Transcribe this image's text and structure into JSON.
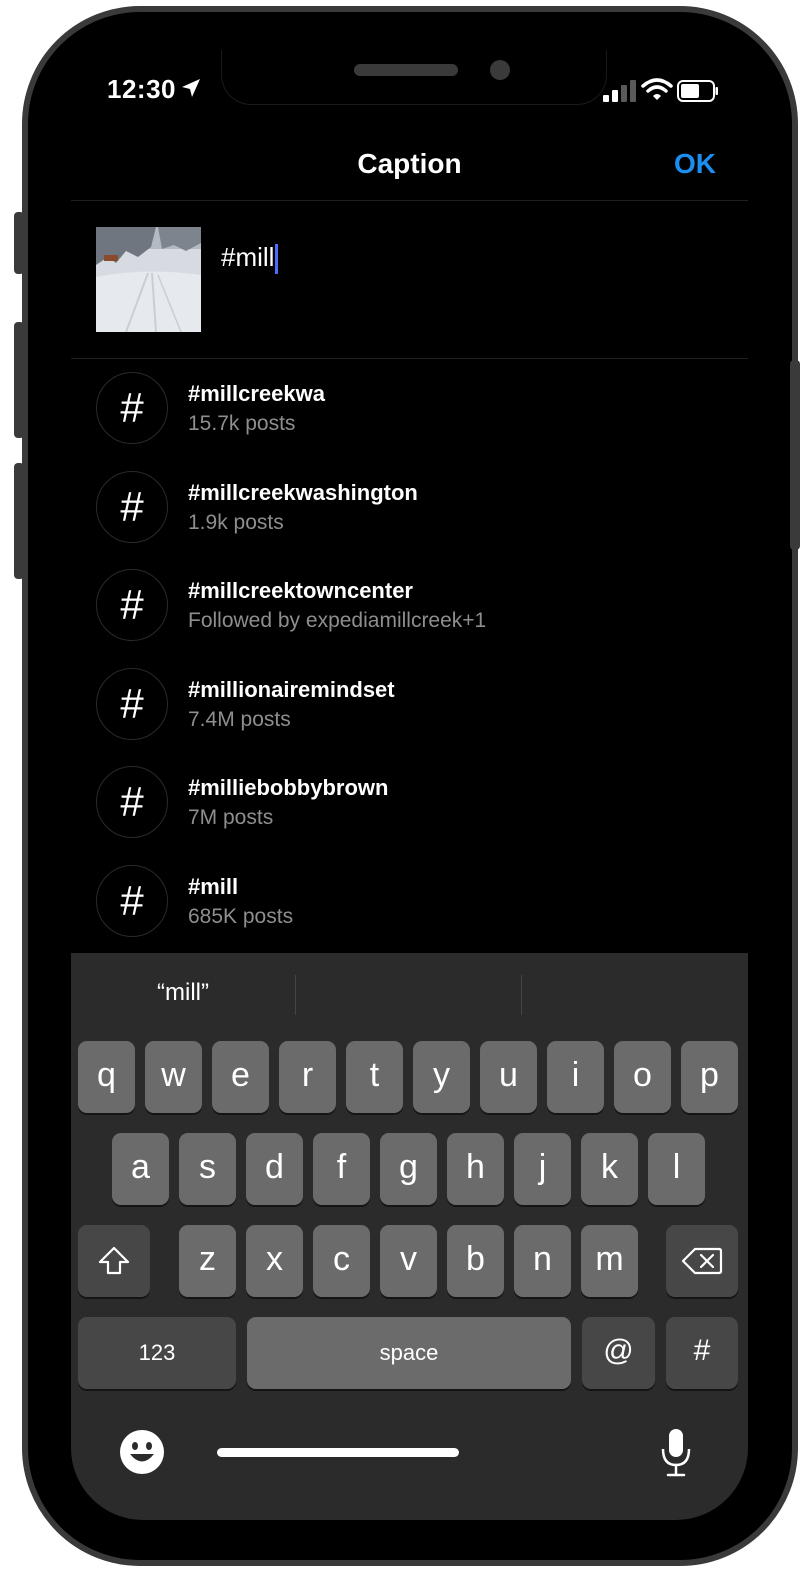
{
  "status_bar": {
    "time": "12:30",
    "location_icon": "location-arrow-icon",
    "signal_icon": "cellular-signal-icon",
    "wifi_icon": "wifi-icon",
    "battery_icon": "battery-icon"
  },
  "header": {
    "title": "Caption",
    "ok_label": "OK"
  },
  "caption": {
    "text": "#mill",
    "thumbnail": "snowy-road-photo"
  },
  "suggestions": [
    {
      "tag": "#millcreekwa",
      "sub": "15.7k posts"
    },
    {
      "tag": "#millcreekwashington",
      "sub": "1.9k posts"
    },
    {
      "tag": "#millcreektowncenter",
      "sub": "Followed by expediamillcreek+1"
    },
    {
      "tag": "#millionairemindset",
      "sub": "7.4M posts"
    },
    {
      "tag": "#milliebobbybrown",
      "sub": "7M posts"
    },
    {
      "tag": "#mill",
      "sub": "685K posts"
    }
  ],
  "hash_symbol": "#",
  "keyboard": {
    "prediction": "“mill”",
    "row1": [
      "q",
      "w",
      "e",
      "r",
      "t",
      "y",
      "u",
      "i",
      "o",
      "p"
    ],
    "row2": [
      "a",
      "s",
      "d",
      "f",
      "g",
      "h",
      "j",
      "k",
      "l"
    ],
    "row3": [
      "z",
      "x",
      "c",
      "v",
      "b",
      "n",
      "m"
    ],
    "num_label": "123",
    "space_label": "space",
    "at_label": "@",
    "hash_label": "#",
    "shift_icon": "shift-icon",
    "delete_icon": "delete-backspace-icon",
    "emoji_icon": "emoji-icon",
    "mic_icon": "microphone-icon"
  },
  "colors": {
    "accent": "#1a8ff0",
    "cursor": "#4a6cff",
    "key": "#6b6b6b",
    "key_dark": "#474747",
    "keyboard_bg": "#2b2b2b"
  }
}
